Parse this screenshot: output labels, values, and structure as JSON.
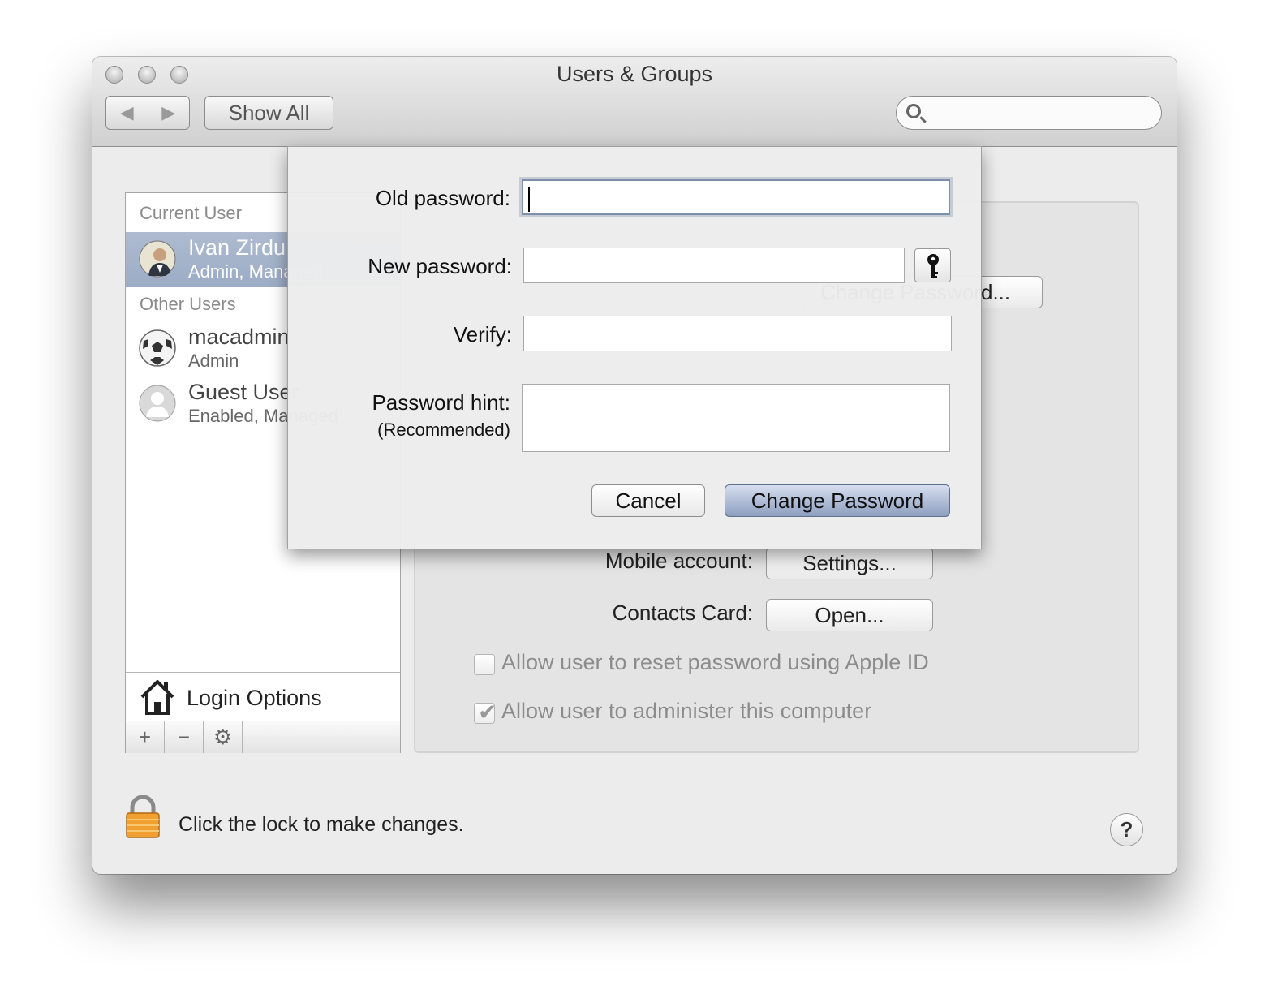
{
  "window": {
    "title": "Users & Groups",
    "toolbar": {
      "back_glyph": "◀",
      "forward_glyph": "▶",
      "show_all_label": "Show All",
      "search_placeholder": "",
      "search_value": ""
    }
  },
  "sidebar": {
    "current_user_header": "Current User",
    "current_user": {
      "name": "Ivan Zirdu",
      "subtitle": "Admin, Managed"
    },
    "other_users_header": "Other Users",
    "other_users": [
      {
        "name": "macadmin",
        "subtitle": "Admin",
        "icon": "soccer-ball-icon"
      },
      {
        "name": "Guest User",
        "subtitle": "Enabled, Managed",
        "icon": "person-silhouette-icon"
      }
    ],
    "login_options_label": "Login Options",
    "toolbar": {
      "add": "+",
      "remove": "−",
      "gear": "⚙"
    }
  },
  "detail": {
    "change_password_button": "Change Password...",
    "mobile_account_label": "Mobile account:",
    "mobile_account_button": "Settings...",
    "contacts_card_label": "Contacts Card:",
    "contacts_card_button": "Open...",
    "checkbox_reset": {
      "label": "Allow user to reset password using Apple ID",
      "checked": false
    },
    "checkbox_admin": {
      "label": "Allow user to administer this computer",
      "checked": true
    }
  },
  "lock": {
    "message": "Click the lock to make changes."
  },
  "help_label": "?",
  "sheet": {
    "old_password_label": "Old password:",
    "old_password_value": "",
    "new_password_label": "New password:",
    "new_password_value": "",
    "verify_label": "Verify:",
    "verify_value": "",
    "hint_label": "Password hint:",
    "hint_sublabel": "(Recommended)",
    "hint_value": "",
    "cancel_label": "Cancel",
    "change_label": "Change Password"
  },
  "colors": {
    "selection": "#9cacc6",
    "default_button": "#8d9fbf",
    "lock": "#f0a030"
  }
}
